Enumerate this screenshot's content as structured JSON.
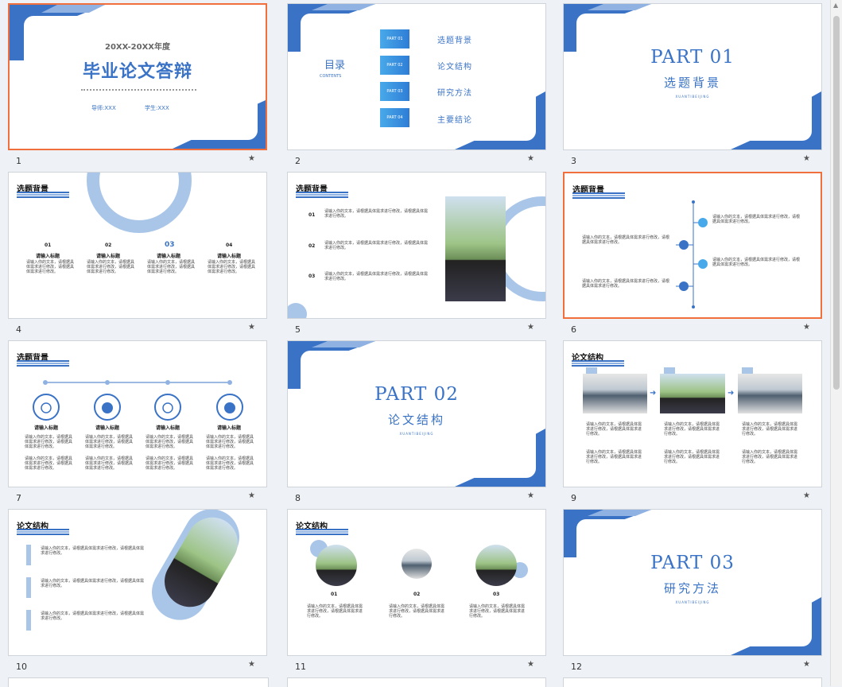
{
  "slides": [
    {
      "number": "1",
      "selected": true,
      "year": "20XX-20XX年度",
      "title": "毕业论文答辩",
      "advisor": "导师:XXX",
      "student": "学生:XXX"
    },
    {
      "number": "2",
      "toc_title": "目录",
      "toc_en": "CONTENTS",
      "items": [
        {
          "btn": "PART 01",
          "text": "选题背景"
        },
        {
          "btn": "PART 02",
          "text": "论文结构"
        },
        {
          "btn": "PART 03",
          "text": "研究方法"
        },
        {
          "btn": "PART 04",
          "text": "主要结论"
        }
      ]
    },
    {
      "number": "3",
      "part": "PART 01",
      "sub": "选题背景",
      "pinyin": "XUANTIBEIJING"
    },
    {
      "number": "4",
      "section": "选题背景",
      "nums": [
        "01",
        "02",
        "03",
        "04"
      ],
      "label": "请输入标题"
    },
    {
      "number": "5",
      "section": "选题背景",
      "nums": [
        "01",
        "02",
        "03"
      ]
    },
    {
      "number": "6",
      "section": "选题背景",
      "selected": true
    },
    {
      "number": "7",
      "section": "选题背景",
      "label": "请输入标题"
    },
    {
      "number": "8",
      "part": "PART 02",
      "sub": "论文结构",
      "pinyin": "XUANTIBEIJING"
    },
    {
      "number": "9",
      "section": "论文结构"
    },
    {
      "number": "10",
      "section": "论文结构"
    },
    {
      "number": "11",
      "section": "论文结构",
      "nums": [
        "01",
        "02",
        "03"
      ]
    },
    {
      "number": "12",
      "part": "PART 03",
      "sub": "研究方法",
      "pinyin": "XUANTIBEIJING"
    }
  ],
  "placeholder_text": "请输入你的文本，请根据具体需求进行修改，请根据具体需求进行修改。",
  "star_icon": "★",
  "colors": {
    "accent": "#3a73c6",
    "light": "#8fb2e3",
    "select": "#f06f3c"
  }
}
